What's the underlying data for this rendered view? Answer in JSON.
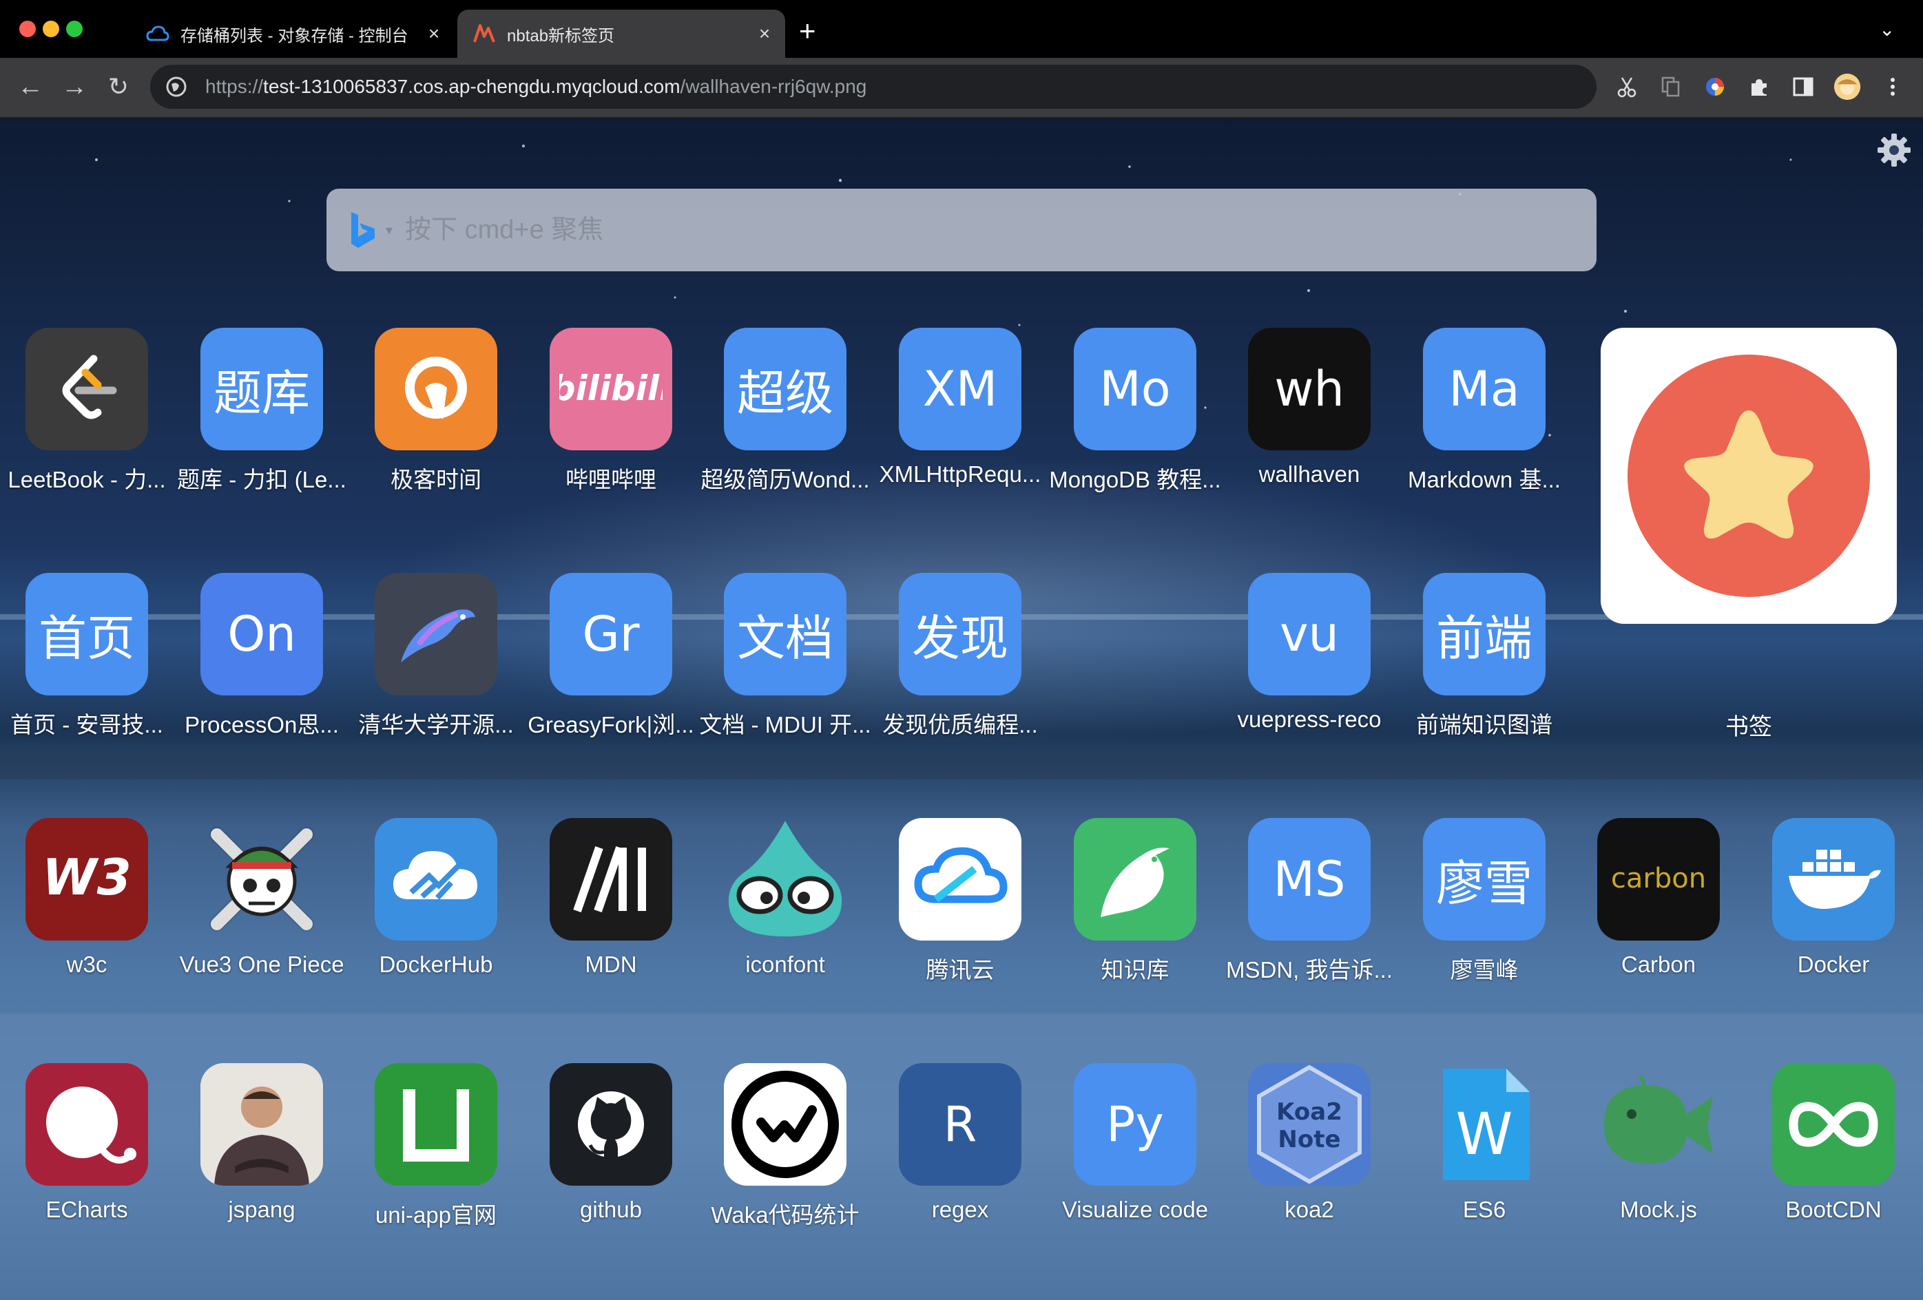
{
  "browser": {
    "tabs": [
      {
        "title": "存储桶列表 - 对象存储 - 控制台",
        "icon": "cloud-icon",
        "active": false
      },
      {
        "title": "nbtab新标签页",
        "icon": "nbtab-icon",
        "active": true
      }
    ],
    "url": {
      "scheme": "https://",
      "host": "test-1310065837.cos.ap-chengdu.myqcloud.com",
      "path": "/wallhaven-rrj6qw.png"
    }
  },
  "search": {
    "placeholder": "按下 cmd+e 聚焦",
    "engine": "bing-icon"
  },
  "apps": [
    {
      "label": "LeetBook - 力...",
      "icon": "leetcode-icon",
      "bg": "#3b3b3b"
    },
    {
      "label": "题库 - 力扣 (Le...",
      "text": "题库",
      "bg": "#4a90f0"
    },
    {
      "label": "极客时间",
      "icon": "geektime-icon",
      "bg": "#f0862e"
    },
    {
      "label": "哔哩哔哩",
      "icon": "bilibili-icon",
      "bg": "#e6739a"
    },
    {
      "label": "超级简历Wond...",
      "text": "超级",
      "bg": "#4a90f0"
    },
    {
      "label": "XMLHttpRequ...",
      "text": "XM",
      "bg": "#4a90f0"
    },
    {
      "label": "MongoDB 教程...",
      "text": "Mo",
      "bg": "#4a90f0"
    },
    {
      "label": "wallhaven",
      "text": "wh",
      "bg": "#111111"
    },
    {
      "label": "Markdown 基...",
      "text": "Ma",
      "bg": "#4a90f0"
    },
    {
      "label": "首页 - 安哥技...",
      "text": "首页",
      "bg": "#4a90f0"
    },
    {
      "label": "ProcessOn思...",
      "text": "On",
      "bg": "#4a7fec"
    },
    {
      "label": "清华大学开源...",
      "icon": "tuna-fish-icon",
      "bg": "#3e4452"
    },
    {
      "label": "GreasyFork|浏...",
      "text": "Gr",
      "bg": "#4a90f0"
    },
    {
      "label": "文档 - MDUI 开...",
      "text": "文档",
      "bg": "#4a90f0"
    },
    {
      "label": "发现优质编程...",
      "text": "发现",
      "bg": "#4a90f0"
    },
    {
      "label": "vuepress-reco",
      "text": "vu",
      "bg": "#4a90f0"
    },
    {
      "label": "前端知识图谱",
      "text": "前端",
      "bg": "#4a90f0"
    },
    {
      "label": "w3c",
      "icon": "w3school-icon",
      "bg": "#8b1a1a"
    },
    {
      "label": "Vue3 One Piece",
      "icon": "jolly-roger-icon",
      "bg": "transparent"
    },
    {
      "label": "DockerHub",
      "icon": "dockerhub-cloud-icon",
      "bg": "#3b8fe0"
    },
    {
      "label": "MDN",
      "icon": "mdn-icon",
      "bg": "#1b1b1b"
    },
    {
      "label": "iconfont",
      "icon": "iconfont-icon",
      "bg": "transparent"
    },
    {
      "label": "腾讯云",
      "icon": "tencent-cloud-icon",
      "bg": "#ffffff"
    },
    {
      "label": "知识库",
      "icon": "yuque-bird-icon",
      "bg": "#3fba6a"
    },
    {
      "label": "MSDN, 我告诉...",
      "text": "MS",
      "bg": "#4a90f0"
    },
    {
      "label": "廖雪峰",
      "text": "廖雪",
      "bg": "#4a90f0"
    },
    {
      "label": "Carbon",
      "icon": "carbon-icon",
      "bg": "#111111",
      "wordmark": "carbon"
    },
    {
      "label": "Docker",
      "icon": "docker-whale-icon",
      "bg": "#3b8fe0"
    },
    {
      "label": "ECharts",
      "icon": "echarts-icon",
      "bg": "#a8213b"
    },
    {
      "label": "jspang",
      "icon": "avatar-photo-icon",
      "bg": "#e8e4de"
    },
    {
      "label": "uni-app官网",
      "icon": "uniapp-icon",
      "bg": "#2b9939"
    },
    {
      "label": "github",
      "icon": "github-icon",
      "bg": "#1b1f23"
    },
    {
      "label": "Waka代码统计",
      "icon": "wakatime-icon",
      "bg": "#ffffff"
    },
    {
      "label": "regex",
      "text": "R",
      "bg": "#2f5a9a"
    },
    {
      "label": "Visualize code",
      "text": "Py",
      "bg": "#4a90f0"
    },
    {
      "label": "koa2",
      "icon": "koa2-icon",
      "bg": "#4d7bd0"
    },
    {
      "label": "ES6",
      "icon": "es6-doc-icon",
      "bg": "transparent",
      "letter": "W"
    },
    {
      "label": "Mock.js",
      "icon": "mockjs-fish-icon",
      "bg": "transparent"
    },
    {
      "label": "BootCDN",
      "icon": "bootcdn-icon",
      "bg": "#36a852"
    }
  ],
  "bookmark": {
    "label": "书签",
    "icon": "star-bookmark-icon"
  }
}
